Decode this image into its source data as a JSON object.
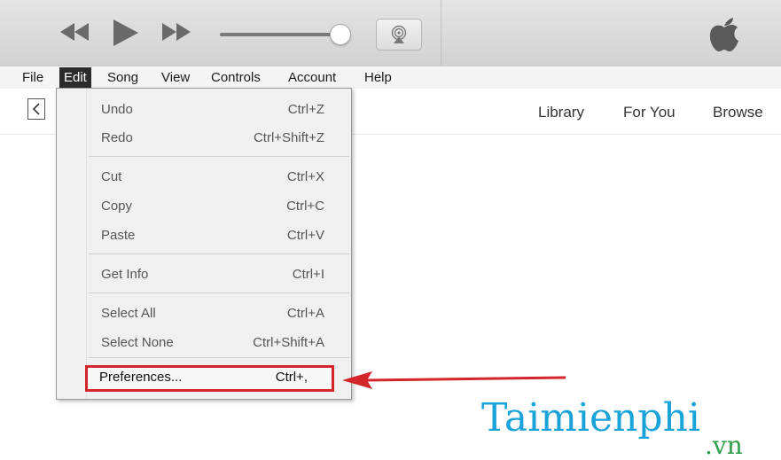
{
  "menubar": {
    "items": [
      {
        "label": "File"
      },
      {
        "label": "Edit"
      },
      {
        "label": "Song"
      },
      {
        "label": "View"
      },
      {
        "label": "Controls"
      },
      {
        "label": "Account"
      },
      {
        "label": "Help"
      }
    ]
  },
  "nav": {
    "back_icon": "<",
    "links": [
      {
        "label": "Library"
      },
      {
        "label": "For You"
      },
      {
        "label": "Browse"
      }
    ]
  },
  "edit_menu": {
    "items": [
      {
        "label": "Undo",
        "shortcut": "Ctrl+Z"
      },
      {
        "label": "Redo",
        "shortcut": "Ctrl+Shift+Z"
      },
      {
        "label": "Cut",
        "shortcut": "Ctrl+X"
      },
      {
        "label": "Copy",
        "shortcut": "Ctrl+C"
      },
      {
        "label": "Paste",
        "shortcut": "Ctrl+V"
      },
      {
        "label": "Get Info",
        "shortcut": "Ctrl+I"
      },
      {
        "label": "Select All",
        "shortcut": "Ctrl+A"
      },
      {
        "label": "Select None",
        "shortcut": "Ctrl+Shift+A"
      },
      {
        "label": "Preferences...",
        "shortcut": "Ctrl+,"
      }
    ]
  },
  "watermark": {
    "brand": "Taimienphi",
    "tld": ".vn"
  },
  "colors": {
    "highlight_border": "#d3252a",
    "arrow": "#d3252a",
    "watermark_blue": "#1aa3d9",
    "watermark_green": "#2e9e48"
  },
  "icons": [
    "rewind-icon",
    "play-icon",
    "fast-forward-icon",
    "airplay-icon",
    "apple-logo-icon",
    "back-chevron-icon"
  ]
}
